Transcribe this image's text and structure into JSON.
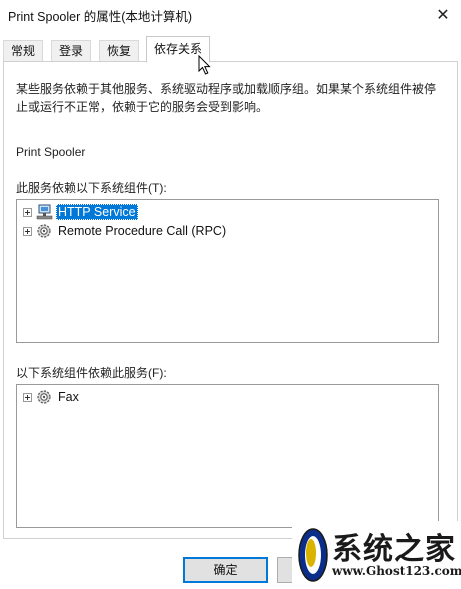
{
  "window": {
    "title": "Print Spooler 的属性(本地计算机)",
    "close_label": "✕"
  },
  "tabs": [
    {
      "label": "常规"
    },
    {
      "label": "登录"
    },
    {
      "label": "恢复"
    },
    {
      "label": "依存关系",
      "active": true
    }
  ],
  "dependencies": {
    "description": "某些服务依赖于其他服务、系统驱动程序或加载顺序组。如果某个系统组件被停止或运行不正常，依赖于它的服务会受到影响。",
    "service_name": "Print Spooler",
    "depends_on_label": "此服务依赖以下系统组件(T):",
    "depends_on": [
      {
        "label": "HTTP Service",
        "icon": "network-component-icon",
        "selected": true
      },
      {
        "label": "Remote Procedure Call (RPC)",
        "icon": "service-gear-icon",
        "selected": false
      }
    ],
    "dependents_label": "以下系统组件依赖此服务(F):",
    "dependents": [
      {
        "label": "Fax",
        "icon": "service-gear-icon",
        "selected": false
      }
    ]
  },
  "buttons": {
    "ok_label": "确定"
  },
  "watermark": {
    "title": "系统之家",
    "url": "www.Ghost123.com"
  }
}
